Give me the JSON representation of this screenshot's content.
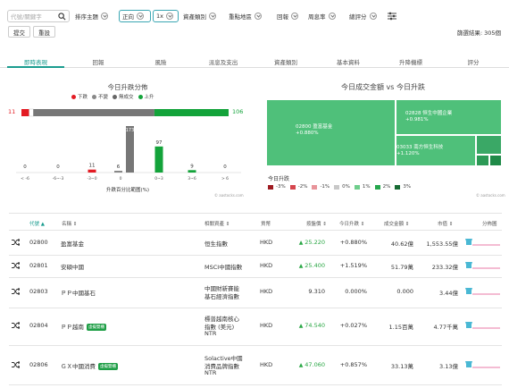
{
  "filters": {
    "search_placeholder": "代號/關鍵字",
    "items": [
      "排序主題",
      "正向",
      "1x",
      "資產類別",
      "重點地區",
      "回報",
      "周息率",
      "總評分"
    ],
    "submit": "提交",
    "reset": "重設",
    "result_label": "篩選結果: 305個"
  },
  "tabs": [
    {
      "label": "即時表現",
      "active": true
    },
    {
      "label": "回報",
      "active": false
    },
    {
      "label": "風險",
      "active": false
    },
    {
      "label": "派息及支出",
      "active": false
    },
    {
      "label": "資產類別",
      "active": false
    },
    {
      "label": "基本資料",
      "active": false
    },
    {
      "label": "升降機標",
      "active": false
    },
    {
      "label": "評分",
      "active": false
    }
  ],
  "chart_data": [
    {
      "type": "bar",
      "title": "今日升跌分佈",
      "legend": [
        "下跌",
        "不變",
        "無成交",
        "上升"
      ],
      "xlabel": "升跌百分比範圍(%)",
      "categories": [
        "< -6",
        "-6~-3",
        "-3~0",
        "0",
        "0~3",
        "3~6",
        "> 6"
      ],
      "values": [
        0,
        0,
        11,
        6,
        97,
        9,
        0
      ],
      "notrade": 173,
      "summary": {
        "down": 11,
        "up": 106
      },
      "colors": {
        "down": "#e31b23",
        "flat": "#888888",
        "notrade": "#777777",
        "up": "#13a33a"
      },
      "source": "© aastocks.com"
    },
    {
      "type": "treemap",
      "title": "今日成交金額 vs 今日升跌",
      "items": [
        {
          "name": "02800 盈富基金",
          "change": "+0.880%"
        },
        {
          "name": "02828 恒生中國企業",
          "change": "+0.981%"
        },
        {
          "name": "03033 南方恒生科技",
          "change": "+1.120%"
        }
      ],
      "legend_title": "今日升跌",
      "legend": [
        {
          "label": "-3%",
          "color": "#9e1b21"
        },
        {
          "label": "-2%",
          "color": "#d6464e"
        },
        {
          "label": "-1%",
          "color": "#e8949a"
        },
        {
          "label": "0%",
          "color": "#c8c8c8"
        },
        {
          "label": "1%",
          "color": "#6fce8c"
        },
        {
          "label": "2%",
          "color": "#26a74d"
        },
        {
          "label": "3%",
          "color": "#176b34"
        }
      ],
      "source": "© aastocks.com"
    }
  ],
  "table": {
    "headers": [
      "代號",
      "名稱",
      "相關資產",
      "貨幣",
      "按盤價",
      "今日升跌",
      "成交金額",
      "市值",
      "分佈圖"
    ],
    "rows": [
      {
        "code": "02800",
        "name": "盈富基金",
        "badge": "",
        "asset": [
          "恒生指數"
        ],
        "ccy": "HKD",
        "price": "25.220",
        "up": true,
        "chg": "+0.880%",
        "turnover": "40.62億",
        "mcap": "1,553.55億"
      },
      {
        "code": "02801",
        "name": "安碩中國",
        "badge": "",
        "asset": [
          "MSCI中國指數"
        ],
        "ccy": "HKD",
        "price": "25.400",
        "up": true,
        "chg": "+1.519%",
        "turnover": "51.79萬",
        "mcap": "233.32億"
      },
      {
        "code": "02803",
        "name": "ＰＰ中國基石",
        "badge": "",
        "asset": [
          "中國財新賽能",
          "基石經濟指數"
        ],
        "ccy": "HKD",
        "price": "9.310",
        "up": false,
        "chg": "0.000%",
        "turnover": "0.000",
        "mcap": "3.44億"
      },
      {
        "code": "02804",
        "name": "ＰＰ越南",
        "badge": "虛擬雙櫃",
        "asset": [
          "標普越南核心",
          "指數 (美元)",
          "NTR"
        ],
        "ccy": "HKD",
        "price": "74.540",
        "up": true,
        "chg": "+0.027%",
        "turnover": "1.15百萬",
        "mcap": "4.77千萬"
      },
      {
        "code": "02806",
        "name": "ＧＸ中國消費",
        "badge": "虛擬雙櫃",
        "asset": [
          "Solactive中國",
          "消費品牌指數",
          "NTR"
        ],
        "ccy": "HKD",
        "price": "47.060",
        "up": true,
        "chg": "+0.857%",
        "turnover": "33.13萬",
        "mcap": "3.13億"
      }
    ]
  }
}
